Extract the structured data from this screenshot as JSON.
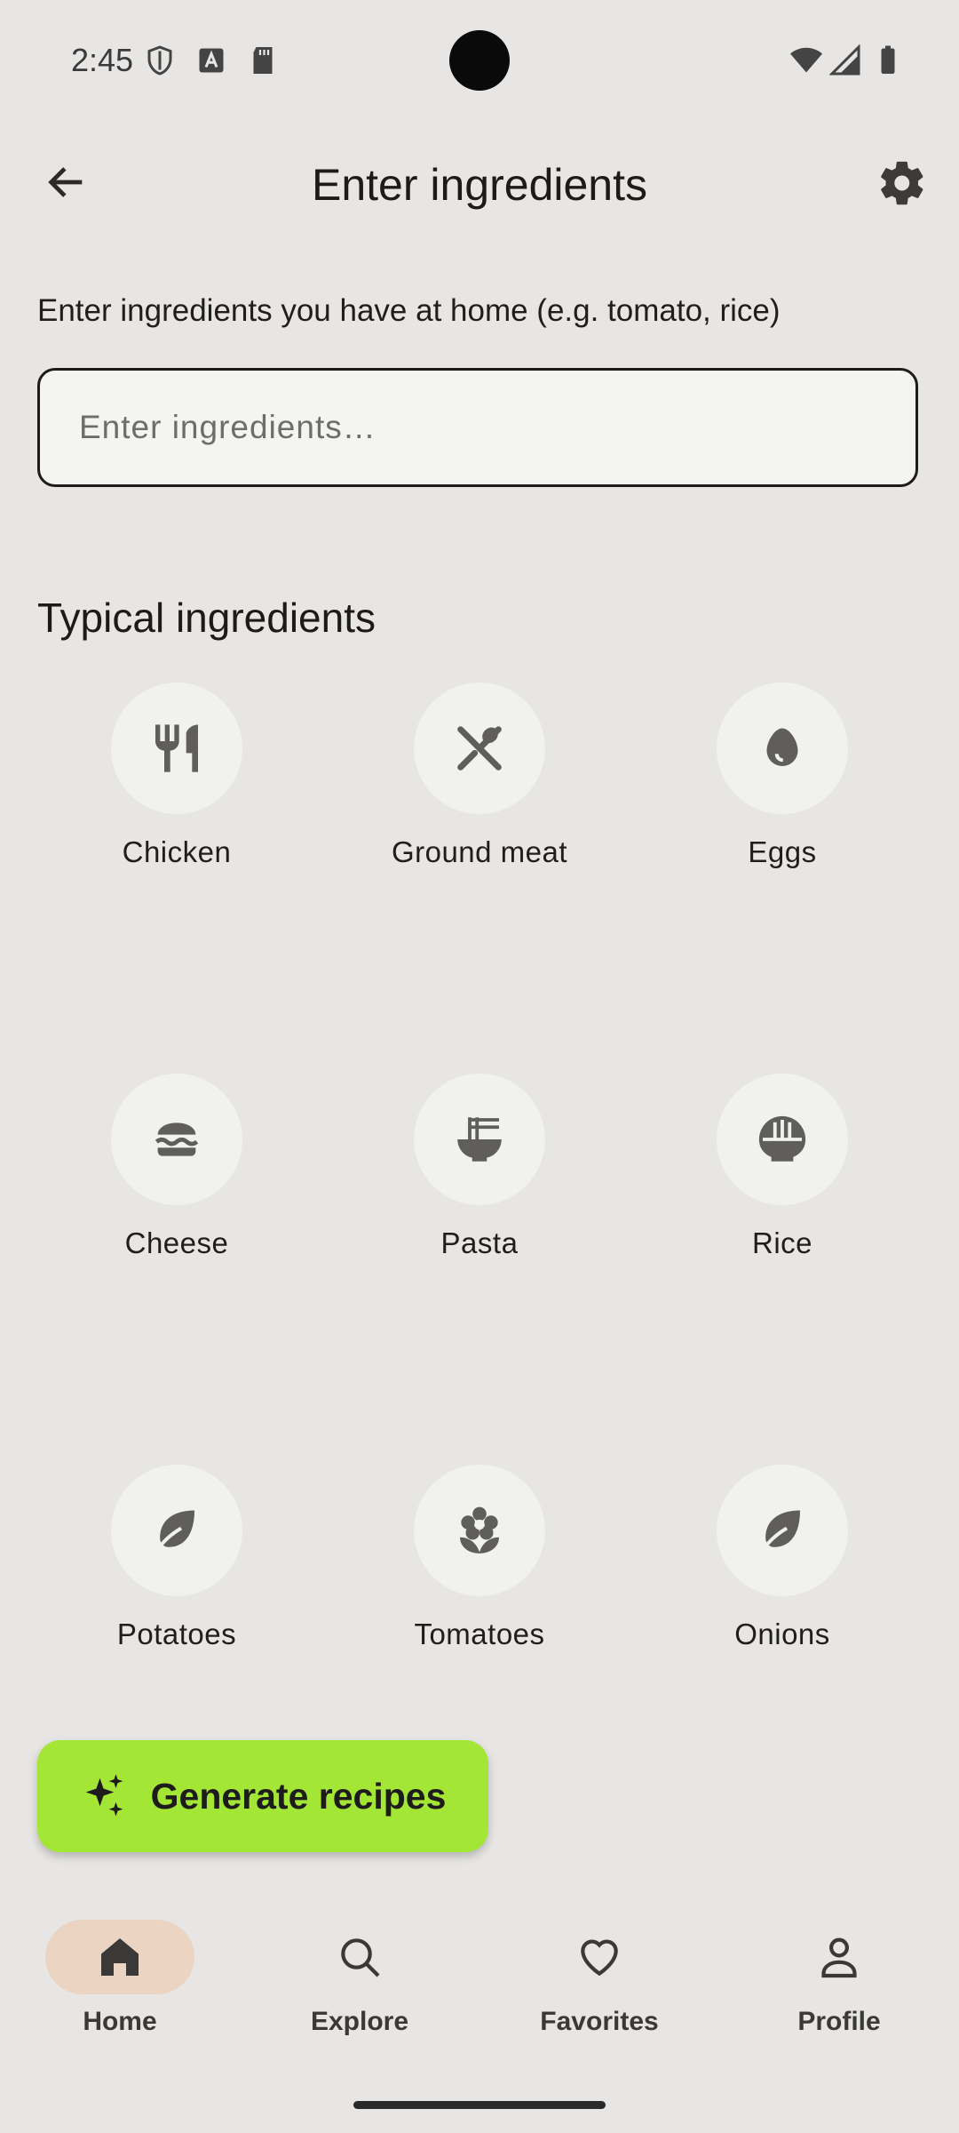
{
  "status_bar": {
    "time": "2:45"
  },
  "app_bar": {
    "title": "Enter ingredients"
  },
  "instruction": "Enter ingredients you have at home (e.g. tomato, rice)",
  "input": {
    "placeholder": "Enter ingredients…",
    "value": ""
  },
  "section_title": "Typical ingredients",
  "ingredients": [
    {
      "label": "Chicken",
      "icon": "restaurant-icon"
    },
    {
      "label": "Ground meat",
      "icon": "utensils-icon"
    },
    {
      "label": "Eggs",
      "icon": "egg-icon"
    },
    {
      "label": "Cheese",
      "icon": "burger-icon"
    },
    {
      "label": "Pasta",
      "icon": "ramen-icon"
    },
    {
      "label": "Rice",
      "icon": "rice-bowl-icon"
    },
    {
      "label": "Potatoes",
      "icon": "leaf-icon"
    },
    {
      "label": "Tomatoes",
      "icon": "flower-icon"
    },
    {
      "label": "Onions",
      "icon": "leaf-icon"
    }
  ],
  "generate_button": {
    "label": "Generate recipes",
    "icon": "sparkles-icon",
    "color": "#a3e635"
  },
  "nav": [
    {
      "label": "Home",
      "icon": "home-icon",
      "active": true
    },
    {
      "label": "Explore",
      "icon": "search-icon",
      "active": false
    },
    {
      "label": "Favorites",
      "icon": "heart-icon",
      "active": false
    },
    {
      "label": "Profile",
      "icon": "person-icon",
      "active": false
    }
  ],
  "colors": {
    "background": "#e7e6e4",
    "accent": "#a3e635",
    "nav_active": "#ebd5c2"
  }
}
